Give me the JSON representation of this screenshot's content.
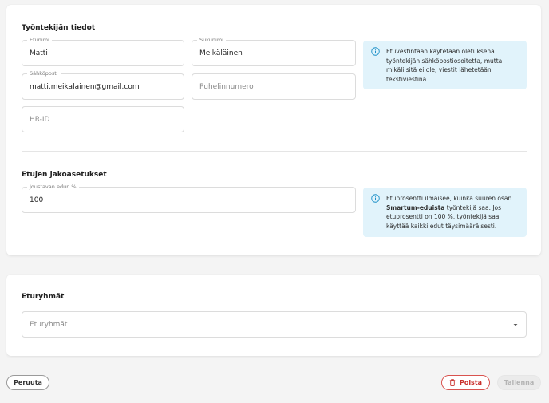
{
  "employee_section": {
    "title": "Työntekijän tiedot",
    "first_name": {
      "label": "Etunimi",
      "value": "Matti"
    },
    "last_name": {
      "label": "Sukunimi",
      "value": "Meikäläinen"
    },
    "email": {
      "label": "Sähköposti",
      "value": "matti.meikalainen@gmail.com"
    },
    "phone": {
      "placeholder": "Puhelinnumero"
    },
    "hr_id": {
      "placeholder": "HR-ID"
    },
    "info_text": "Etuvestintään käytetään oletuksena työntekijän sähköpostiosoitetta, mutta mikäli sitä ei ole, viestit lähetetään tekstiviestinä."
  },
  "benefit_section": {
    "title": "Etujen jakoasetukset",
    "percent": {
      "label": "Joustavan edun %",
      "value": "100"
    },
    "info": {
      "before": "Etuprosentti ilmaisee, kuinka suuren osan ",
      "bold": "Smartum-eduista",
      "after": " työntekijä saa. Jos etuprosentti on 100 %, työntekijä saa käyttää kaikki edut täysimääräisesti."
    }
  },
  "groups_section": {
    "title": "Eturyhmät",
    "select_placeholder": "Eturyhmät"
  },
  "footer": {
    "cancel_label": "Peruuta",
    "delete_label": "Poista",
    "save_label": "Tallenna"
  },
  "icons": {
    "info": "info-circle-icon",
    "delete": "trash-icon",
    "dropdown": "chevron-down-icon"
  },
  "colors": {
    "info_background": "#e1f3fb",
    "info_icon": "#1a8fc7",
    "danger": "#c9302c",
    "disabled_background": "#ebebeb"
  }
}
